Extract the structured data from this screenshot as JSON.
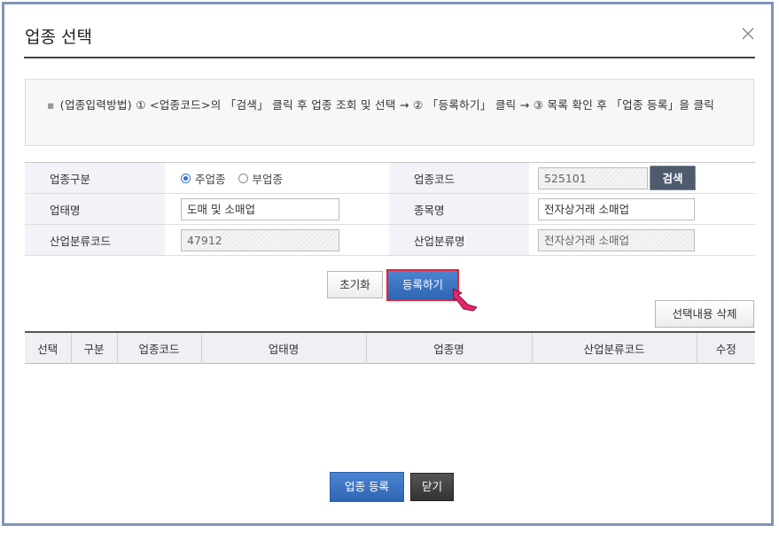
{
  "dialog": {
    "title": "업종 선택"
  },
  "notice": {
    "text": "(업종입력방법) ① <업종코드>의 「검색」 클릭 후 업종 조회 및 선택 → ② 「등록하기」 클릭 → ③ 목록 확인 후 「업종 등록」을 클릭"
  },
  "form": {
    "category_label": "업종구분",
    "radio_primary": "주업종",
    "radio_secondary": "부업종",
    "selected_radio": "주업종",
    "code_label": "업종코드",
    "code_value": "525101",
    "search_button": "검색",
    "business_type_label": "업태명",
    "business_type_value": "도매 및 소매업",
    "item_label": "종목명",
    "item_value": "전자상거래 소매업",
    "industry_code_label": "산업분류코드",
    "industry_code_value": "47912",
    "industry_name_label": "산업분류명",
    "industry_name_value": "전자상거래 소매업"
  },
  "actions": {
    "reset": "초기화",
    "register": "등록하기",
    "delete_selection": "선택내용 삭제"
  },
  "table": {
    "columns": [
      "선택",
      "구분",
      "업종코드",
      "업태명",
      "업종명",
      "산업분류코드",
      "수정"
    ],
    "rows": []
  },
  "footer": {
    "submit": "업종 등록",
    "close": "닫기"
  },
  "colors": {
    "primary_button": "#3a73c2",
    "highlight_border": "#e8233a",
    "cursor": "#e2266f"
  }
}
